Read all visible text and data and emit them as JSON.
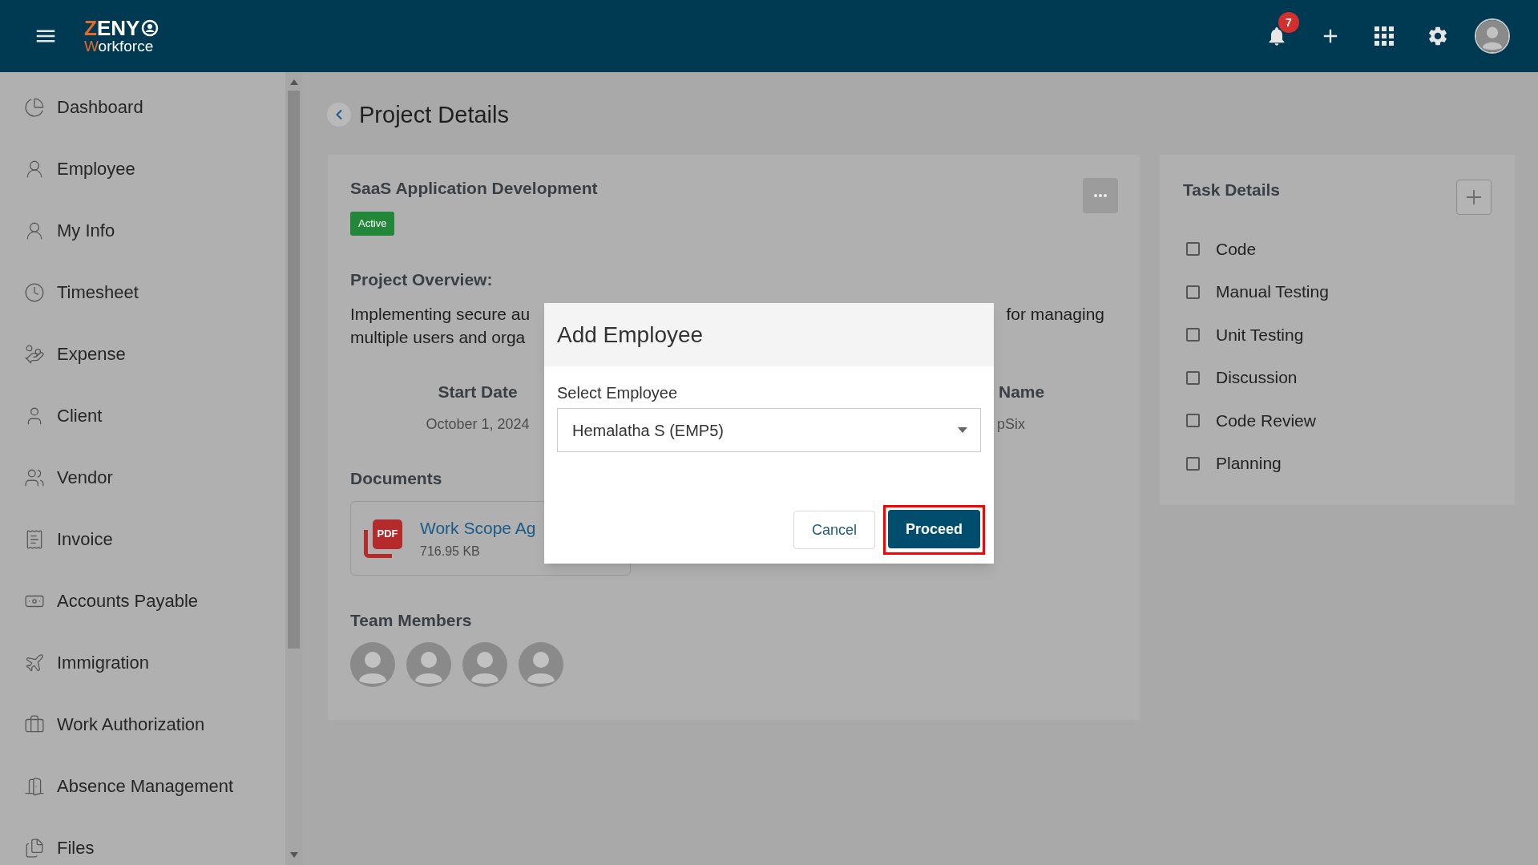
{
  "header": {
    "logo": {
      "name": "ZENY",
      "tagline": "Workforce"
    },
    "notification_count": "7"
  },
  "sidebar": {
    "items": [
      {
        "label": "Dashboard"
      },
      {
        "label": "Employee"
      },
      {
        "label": "My Info"
      },
      {
        "label": "Timesheet"
      },
      {
        "label": "Expense"
      },
      {
        "label": "Client"
      },
      {
        "label": "Vendor"
      },
      {
        "label": "Invoice"
      },
      {
        "label": "Accounts Payable"
      },
      {
        "label": "Immigration"
      },
      {
        "label": "Work Authorization"
      },
      {
        "label": "Absence Management"
      },
      {
        "label": "Files"
      }
    ]
  },
  "page": {
    "title": "Project Details"
  },
  "project": {
    "title": "SaaS Application Development",
    "status": "Active",
    "overview": {
      "heading": "Project Overview:",
      "lines": [
        {
          "left": "Implementing secure au",
          "right": "for managing"
        },
        {
          "left": "multiple users and orga"
        }
      ]
    },
    "details": [
      {
        "label": "Start Date",
        "value": "October 1, 2024"
      },
      {
        "label": "Name",
        "value": "pSix"
      }
    ],
    "documents": {
      "heading": "Documents",
      "files": [
        {
          "type": "PDF",
          "name": "Work Scope Ag",
          "size": "716.95 KB"
        }
      ]
    },
    "team": {
      "heading": "Team Members",
      "members": [
        {
          "kind": "photo"
        },
        {
          "kind": "photo"
        },
        {
          "kind": "photo"
        },
        {
          "kind": "photo"
        }
      ]
    }
  },
  "tasks": {
    "title": "Task Details",
    "items": [
      {
        "label": "Code",
        "checked": false
      },
      {
        "label": "Manual Testing",
        "checked": false
      },
      {
        "label": "Unit Testing",
        "checked": false
      },
      {
        "label": "Discussion",
        "checked": false
      },
      {
        "label": "Code Review",
        "checked": false
      },
      {
        "label": "Planning",
        "checked": false
      }
    ]
  },
  "dialog": {
    "title": "Add Employee",
    "field": {
      "label": "Select Employee",
      "value": "Hemalatha S (EMP5)"
    },
    "buttons": [
      {
        "label": "Cancel",
        "kind": "secondary",
        "highlighted": false
      },
      {
        "label": "Proceed",
        "kind": "primary",
        "highlighted": true
      }
    ]
  }
}
